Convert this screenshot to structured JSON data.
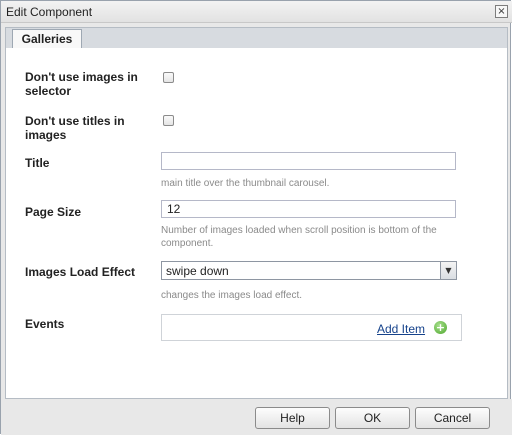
{
  "window": {
    "title": "Edit Component",
    "close_glyph": "×"
  },
  "tabs": [
    {
      "label": "Galleries"
    }
  ],
  "form": {
    "no_images_label": "Don't use images in selector",
    "no_titles_label": "Don't use titles in images",
    "title": {
      "label": "Title",
      "value": "",
      "hint": "main title over the thumbnail carousel."
    },
    "page_size": {
      "label": "Page Size",
      "value": "12",
      "hint": "Number of images loaded when scroll position is bottom of the component."
    },
    "load_effect": {
      "label": "Images Load Effect",
      "selected": "swipe down",
      "hint": "changes the images load effect."
    },
    "events": {
      "label": "Events",
      "add_label": "Add Item",
      "add_glyph": "+"
    }
  },
  "buttons": {
    "help": "Help",
    "ok": "OK",
    "cancel": "Cancel"
  },
  "icons": {
    "close": "close-icon",
    "add": "add-icon",
    "dropdown": "chevron-down-icon"
  },
  "colors": {
    "link": "#15428b",
    "add_icon": "#4ea72d"
  }
}
